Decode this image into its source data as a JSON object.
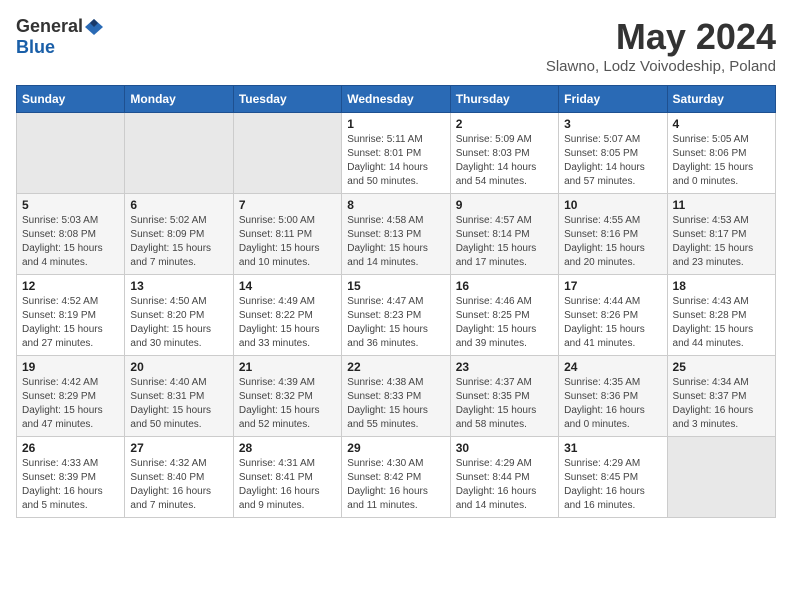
{
  "header": {
    "logo_general": "General",
    "logo_blue": "Blue",
    "month_title": "May 2024",
    "location": "Slawno, Lodz Voivodeship, Poland"
  },
  "weekdays": [
    "Sunday",
    "Monday",
    "Tuesday",
    "Wednesday",
    "Thursday",
    "Friday",
    "Saturday"
  ],
  "weeks": [
    [
      {
        "day": "",
        "info": ""
      },
      {
        "day": "",
        "info": ""
      },
      {
        "day": "",
        "info": ""
      },
      {
        "day": "1",
        "info": "Sunrise: 5:11 AM\nSunset: 8:01 PM\nDaylight: 14 hours\nand 50 minutes."
      },
      {
        "day": "2",
        "info": "Sunrise: 5:09 AM\nSunset: 8:03 PM\nDaylight: 14 hours\nand 54 minutes."
      },
      {
        "day": "3",
        "info": "Sunrise: 5:07 AM\nSunset: 8:05 PM\nDaylight: 14 hours\nand 57 minutes."
      },
      {
        "day": "4",
        "info": "Sunrise: 5:05 AM\nSunset: 8:06 PM\nDaylight: 15 hours\nand 0 minutes."
      }
    ],
    [
      {
        "day": "5",
        "info": "Sunrise: 5:03 AM\nSunset: 8:08 PM\nDaylight: 15 hours\nand 4 minutes."
      },
      {
        "day": "6",
        "info": "Sunrise: 5:02 AM\nSunset: 8:09 PM\nDaylight: 15 hours\nand 7 minutes."
      },
      {
        "day": "7",
        "info": "Sunrise: 5:00 AM\nSunset: 8:11 PM\nDaylight: 15 hours\nand 10 minutes."
      },
      {
        "day": "8",
        "info": "Sunrise: 4:58 AM\nSunset: 8:13 PM\nDaylight: 15 hours\nand 14 minutes."
      },
      {
        "day": "9",
        "info": "Sunrise: 4:57 AM\nSunset: 8:14 PM\nDaylight: 15 hours\nand 17 minutes."
      },
      {
        "day": "10",
        "info": "Sunrise: 4:55 AM\nSunset: 8:16 PM\nDaylight: 15 hours\nand 20 minutes."
      },
      {
        "day": "11",
        "info": "Sunrise: 4:53 AM\nSunset: 8:17 PM\nDaylight: 15 hours\nand 23 minutes."
      }
    ],
    [
      {
        "day": "12",
        "info": "Sunrise: 4:52 AM\nSunset: 8:19 PM\nDaylight: 15 hours\nand 27 minutes."
      },
      {
        "day": "13",
        "info": "Sunrise: 4:50 AM\nSunset: 8:20 PM\nDaylight: 15 hours\nand 30 minutes."
      },
      {
        "day": "14",
        "info": "Sunrise: 4:49 AM\nSunset: 8:22 PM\nDaylight: 15 hours\nand 33 minutes."
      },
      {
        "day": "15",
        "info": "Sunrise: 4:47 AM\nSunset: 8:23 PM\nDaylight: 15 hours\nand 36 minutes."
      },
      {
        "day": "16",
        "info": "Sunrise: 4:46 AM\nSunset: 8:25 PM\nDaylight: 15 hours\nand 39 minutes."
      },
      {
        "day": "17",
        "info": "Sunrise: 4:44 AM\nSunset: 8:26 PM\nDaylight: 15 hours\nand 41 minutes."
      },
      {
        "day": "18",
        "info": "Sunrise: 4:43 AM\nSunset: 8:28 PM\nDaylight: 15 hours\nand 44 minutes."
      }
    ],
    [
      {
        "day": "19",
        "info": "Sunrise: 4:42 AM\nSunset: 8:29 PM\nDaylight: 15 hours\nand 47 minutes."
      },
      {
        "day": "20",
        "info": "Sunrise: 4:40 AM\nSunset: 8:31 PM\nDaylight: 15 hours\nand 50 minutes."
      },
      {
        "day": "21",
        "info": "Sunrise: 4:39 AM\nSunset: 8:32 PM\nDaylight: 15 hours\nand 52 minutes."
      },
      {
        "day": "22",
        "info": "Sunrise: 4:38 AM\nSunset: 8:33 PM\nDaylight: 15 hours\nand 55 minutes."
      },
      {
        "day": "23",
        "info": "Sunrise: 4:37 AM\nSunset: 8:35 PM\nDaylight: 15 hours\nand 58 minutes."
      },
      {
        "day": "24",
        "info": "Sunrise: 4:35 AM\nSunset: 8:36 PM\nDaylight: 16 hours\nand 0 minutes."
      },
      {
        "day": "25",
        "info": "Sunrise: 4:34 AM\nSunset: 8:37 PM\nDaylight: 16 hours\nand 3 minutes."
      }
    ],
    [
      {
        "day": "26",
        "info": "Sunrise: 4:33 AM\nSunset: 8:39 PM\nDaylight: 16 hours\nand 5 minutes."
      },
      {
        "day": "27",
        "info": "Sunrise: 4:32 AM\nSunset: 8:40 PM\nDaylight: 16 hours\nand 7 minutes."
      },
      {
        "day": "28",
        "info": "Sunrise: 4:31 AM\nSunset: 8:41 PM\nDaylight: 16 hours\nand 9 minutes."
      },
      {
        "day": "29",
        "info": "Sunrise: 4:30 AM\nSunset: 8:42 PM\nDaylight: 16 hours\nand 11 minutes."
      },
      {
        "day": "30",
        "info": "Sunrise: 4:29 AM\nSunset: 8:44 PM\nDaylight: 16 hours\nand 14 minutes."
      },
      {
        "day": "31",
        "info": "Sunrise: 4:29 AM\nSunset: 8:45 PM\nDaylight: 16 hours\nand 16 minutes."
      },
      {
        "day": "",
        "info": ""
      }
    ]
  ]
}
